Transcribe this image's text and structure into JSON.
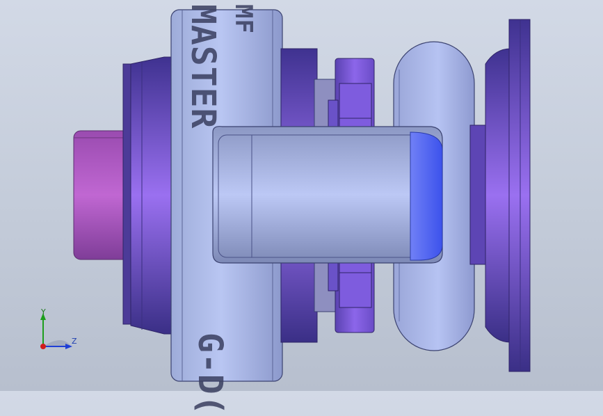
{
  "viewport": {
    "engraving_top_1": "MF",
    "engraving_top_2": "MASTER",
    "engraving_bottom": "G-D("
  },
  "triad": {
    "y_label": "Y",
    "z_label": "Z",
    "colors": {
      "y": "#1d9e1d",
      "z": "#1f3fd6",
      "x": "#d01c1c"
    }
  },
  "colors": {
    "background": "#c6cedc",
    "steel_light": "#b7c4ef",
    "steel_mid": "#9aa8de",
    "purple": "#7a55d8",
    "purple_dark": "#4d3a9a",
    "magenta": "#b058c2",
    "blue_accent": "#4a5cf0"
  }
}
